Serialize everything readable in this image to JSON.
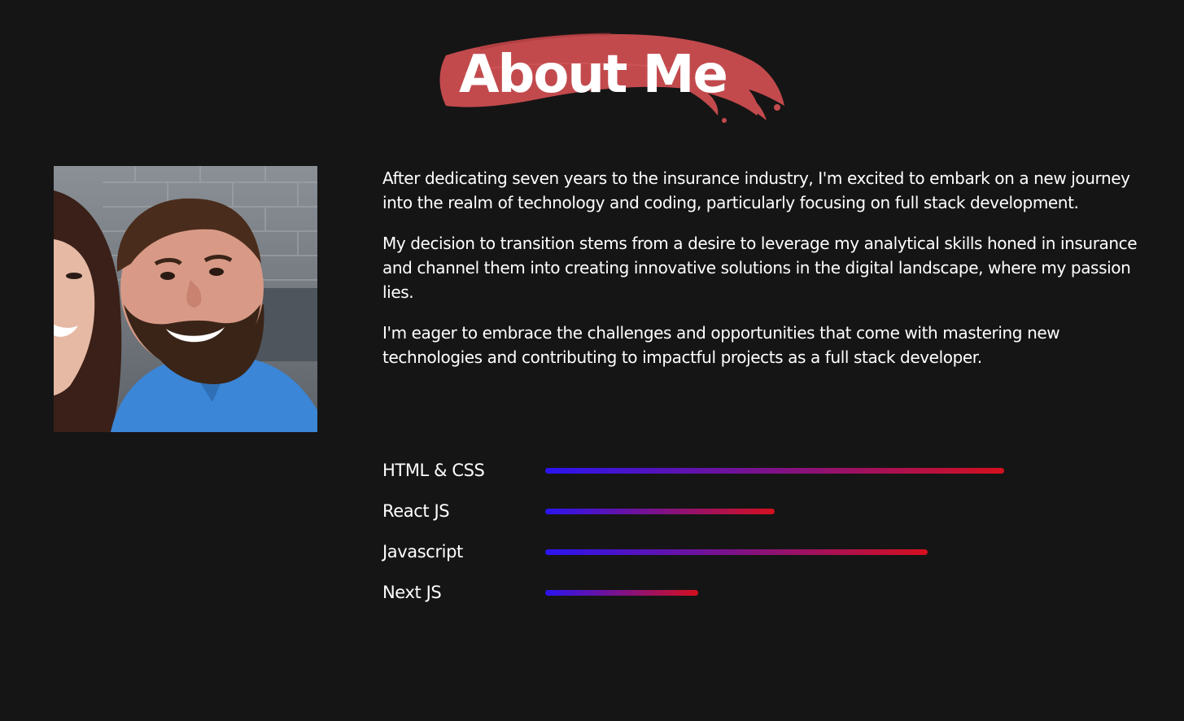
{
  "title": "About Me",
  "colors": {
    "background": "#161515",
    "brush": "#c24a4d",
    "text": "#ffffff",
    "bar_start": "#2a14f0",
    "bar_end": "#d4101e"
  },
  "photo": {
    "alt": "Profile photo"
  },
  "paragraphs": [
    "After dedicating seven years to the insurance industry, I'm excited to embark on a new journey into the realm of technology and coding, particularly focusing on full stack development.",
    "My decision to transition stems from a desire to leverage my analytical skills honed in insurance and channel them into creating innovative solutions in the digital landscape, where my passion lies.",
    "I'm eager to embrace the challenges and opportunities that come with mastering new technologies and contributing to impactful projects as a full stack developer."
  ],
  "skills": [
    {
      "name": "HTML & CSS",
      "level": 0.6
    },
    {
      "name": "React JS",
      "level": 0.3
    },
    {
      "name": "Javascript",
      "level": 0.5
    },
    {
      "name": "Next JS",
      "level": 0.2
    }
  ]
}
